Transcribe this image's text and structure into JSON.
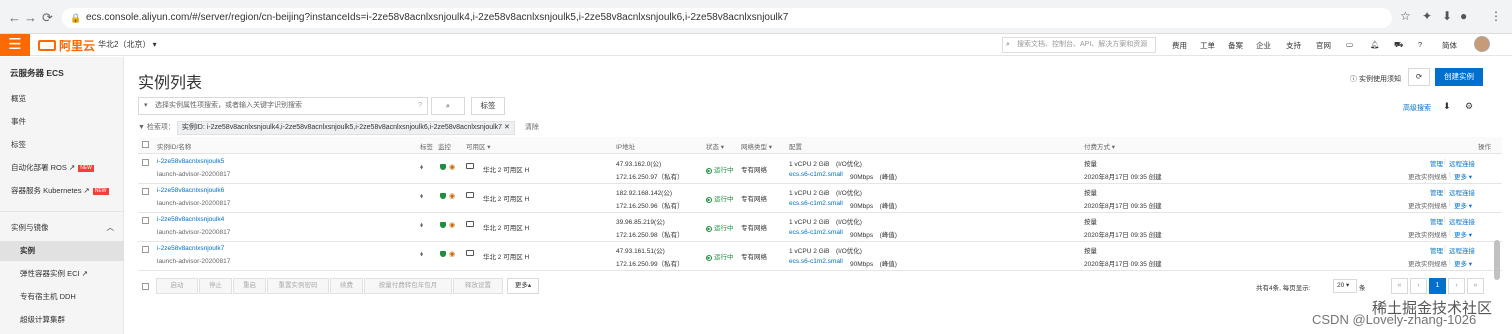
{
  "browser": {
    "url": "ecs.console.aliyun.com/#/server/region/cn-beijing?instanceIds=i-2ze58v8acnlxsnjoulk4,i-2ze58v8acnlxsnjoulk5,i-2ze58v8acnlxsnjoulk6,i-2ze58v8acnlxsnjoulk7"
  },
  "topbar": {
    "logo_text": "阿里云",
    "region": "华北2（北京）",
    "search_placeholder": "搜索文档、控制台、API、解决方案和资源",
    "nav": [
      "费用",
      "工单",
      "备案",
      "企业",
      "支持",
      "官网"
    ],
    "lang": "简体"
  },
  "sidebar": {
    "title": "云服务器 ECS",
    "items": [
      {
        "label": "概览"
      },
      {
        "label": "事件"
      },
      {
        "label": "标签"
      },
      {
        "label": "自动化部署 ROS",
        "ext": "↗",
        "badge": "NEW"
      },
      {
        "label": "容器服务 Kubernetes",
        "ext": "↗",
        "badge": "NEW"
      },
      {
        "label": "实例与镜像",
        "chevron": "︿"
      },
      {
        "label": "实例"
      },
      {
        "label": "弹性容器实例 ECI",
        "ext": "↗"
      },
      {
        "label": "专有宿主机 DDH"
      },
      {
        "label": "超级计算集群"
      }
    ]
  },
  "main": {
    "title": "实例列表",
    "help": "实例使用须知",
    "create_button": "创建实例",
    "search_placeholder": "选择实例属性项搜索，或者输入关键字识别搜索",
    "tag_button": "标签",
    "advanced_search": "高级搜索",
    "filter_label": "检索项：",
    "filter_tag": "实例ID: i-2ze58v8acnlxsnjoulk4,i-2ze58v8acnlxsnjoulk5,i-2ze58v8acnlxsnjoulk6,i-2ze58v8acnlxsnjoulk7",
    "filter_remove": "✕",
    "clear": "清除"
  },
  "table": {
    "headers": {
      "id": "实例ID/名称",
      "tag": "标签",
      "monitor": "监控",
      "zone": "可用区 ▾",
      "ip": "IP地址",
      "status": "状态 ▾",
      "net": "网络类型 ▾",
      "config": "配置",
      "billing": "付费方式 ▾",
      "ops": "操作"
    },
    "rows": [
      {
        "id": "i-2ze58v8acnlxsnjoulk5",
        "name": "launch-advisor-20200817",
        "zone": "华北 2 可用区 H",
        "ip_pub": "47.93.162.0(公)",
        "ip_priv": "172.16.250.97（私有）",
        "status": "运行中",
        "net": "专有网络",
        "cfg1": "1 vCPU 2 GiB　(I/O优化)",
        "cfg2": "ecs.s6-c1m2.small",
        "bw": "90Mbps　(峰值)",
        "billing": "按量",
        "created": "2020年8月17日 09:35 创建",
        "op1": "管理",
        "op2": "远程连接",
        "op3": "更改实例规格",
        "op4": "更多 ▾"
      },
      {
        "id": "i-2ze58v8acnlxsnjoulk6",
        "name": "launch-advisor-20200817",
        "zone": "华北 2 可用区 H",
        "ip_pub": "182.92.168.142(公)",
        "ip_priv": "172.16.250.96（私有）",
        "status": "运行中",
        "net": "专有网络",
        "cfg1": "1 vCPU 2 GiB　(I/O优化)",
        "cfg2": "ecs.s6-c1m2.small",
        "bw": "90Mbps　(峰值)",
        "billing": "按量",
        "created": "2020年8月17日 09:35 创建",
        "op1": "管理",
        "op2": "远程连接",
        "op3": "更改实例规格",
        "op4": "更多 ▾"
      },
      {
        "id": "i-2ze58v8acnlxsnjoulk4",
        "name": "launch-advisor-20200817",
        "zone": "华北 2 可用区 H",
        "ip_pub": "39.96.85.219(公)",
        "ip_priv": "172.16.250.98（私有）",
        "status": "运行中",
        "net": "专有网络",
        "cfg1": "1 vCPU 2 GiB　(I/O优化)",
        "cfg2": "ecs.s6-c1m2.small",
        "bw": "90Mbps　(峰值)",
        "billing": "按量",
        "created": "2020年8月17日 09:35 创建",
        "op1": "管理",
        "op2": "远程连接",
        "op3": "更改实例规格",
        "op4": "更多 ▾"
      },
      {
        "id": "i-2ze58v8acnlxsnjoulk7",
        "name": "launch-advisor-20200817",
        "zone": "华北 2 可用区 H",
        "ip_pub": "47.93.161.51(公)",
        "ip_priv": "172.16.250.99（私有）",
        "status": "运行中",
        "net": "专有网络",
        "cfg1": "1 vCPU 2 GiB　(I/O优化)",
        "cfg2": "ecs.s6-c1m2.small",
        "bw": "90Mbps　(峰值)",
        "billing": "按量",
        "created": "2020年8月17日 09:35 创建",
        "op1": "管理",
        "op2": "远程连接",
        "op3": "更改实例规格",
        "op4": "更多 ▾"
      }
    ]
  },
  "footer": {
    "buttons": [
      "启动",
      "停止",
      "重启",
      "重置实例密码",
      "续费",
      "按量付费转包年包月",
      "释放设置"
    ],
    "more": "更多▴",
    "total": "共有4条, 每页显示:",
    "page_size": "20",
    "page_unit": "条",
    "pages": [
      "«",
      "‹",
      "1",
      "›",
      "»"
    ]
  },
  "watermark": "CSDN @Lovely-zhang-1026",
  "watermark2": "稀土掘金技术社区"
}
